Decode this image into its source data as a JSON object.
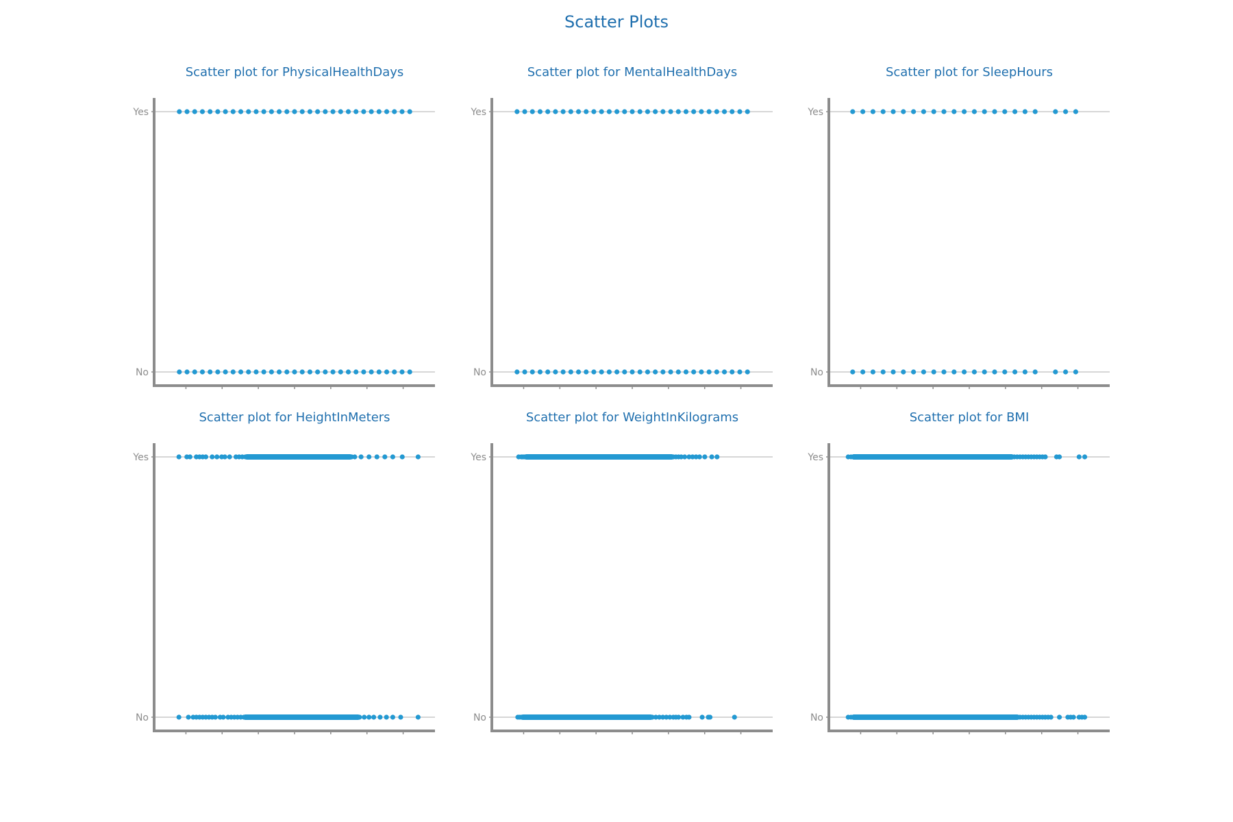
{
  "figure": {
    "title": "Scatter Plots",
    "point_color": "#2399d2",
    "title_color": "#1f6fae",
    "axis_color": "#8c8c8c",
    "grid_color": "#c8c8c8",
    "tick_label_color": "#8c8c8c"
  },
  "chart_data": [
    {
      "type": "scatter",
      "title": "Scatter plot for PhysicalHealthDays",
      "xlim": [
        -1.5,
        31.5
      ],
      "y_categories": [
        "No",
        "Yes"
      ],
      "grid": "horizontal",
      "series": [
        {
          "y": "Yes",
          "x": [
            0,
            1,
            2,
            3,
            4,
            5,
            6,
            7,
            8,
            9,
            10,
            11,
            12,
            13,
            14,
            15,
            16,
            17,
            18,
            19,
            20,
            21,
            22,
            23,
            24,
            25,
            26,
            27,
            28,
            29,
            30
          ]
        },
        {
          "y": "No",
          "x": [
            0,
            1,
            2,
            3,
            4,
            5,
            6,
            7,
            8,
            9,
            10,
            11,
            12,
            13,
            14,
            15,
            16,
            17,
            18,
            19,
            20,
            21,
            22,
            23,
            24,
            25,
            26,
            27,
            28,
            29,
            30
          ]
        }
      ]
    },
    {
      "type": "scatter",
      "title": "Scatter plot for MentalHealthDays",
      "xlim": [
        -1.5,
        31.5
      ],
      "y_categories": [
        "No",
        "Yes"
      ],
      "grid": "horizontal",
      "series": [
        {
          "y": "Yes",
          "x": [
            0,
            1,
            2,
            3,
            4,
            5,
            6,
            7,
            8,
            9,
            10,
            11,
            12,
            13,
            14,
            15,
            16,
            17,
            18,
            19,
            20,
            21,
            22,
            23,
            24,
            25,
            26,
            27,
            28,
            29,
            30
          ]
        },
        {
          "y": "No",
          "x": [
            0,
            1,
            2,
            3,
            4,
            5,
            6,
            7,
            8,
            9,
            10,
            11,
            12,
            13,
            14,
            15,
            16,
            17,
            18,
            19,
            20,
            21,
            22,
            23,
            24,
            25,
            26,
            27,
            28,
            29,
            30
          ]
        }
      ]
    },
    {
      "type": "scatter",
      "title": "Scatter plot for SleepHours",
      "xlim": [
        0,
        25
      ],
      "y_categories": [
        "No",
        "Yes"
      ],
      "grid": "horizontal",
      "series": [
        {
          "y": "Yes",
          "x": [
            1,
            2,
            3,
            4,
            5,
            6,
            7,
            8,
            9,
            10,
            11,
            12,
            13,
            14,
            15,
            16,
            17,
            18,
            19,
            21,
            22,
            23
          ]
        },
        {
          "y": "No",
          "x": [
            1,
            2,
            3,
            4,
            5,
            6,
            7,
            8,
            9,
            10,
            11,
            12,
            13,
            14,
            15,
            16,
            17,
            18,
            19,
            21,
            22,
            23
          ]
        }
      ]
    },
    {
      "type": "scatter",
      "title": "Scatter plot for HeightInMeters",
      "xlim": [
        0.9,
        2.5
      ],
      "y_categories": [
        "No",
        "Yes"
      ],
      "grid": "horizontal",
      "series": [
        {
          "y": "Yes",
          "x": [
            0.97,
            1.02,
            1.04,
            1.08,
            1.1,
            1.12,
            1.14,
            1.18,
            1.21,
            1.24,
            1.26,
            1.29,
            1.33,
            1.35,
            1.37,
            1.39,
            2.06,
            2.08,
            2.12,
            2.17,
            2.22,
            2.27,
            2.32,
            2.38,
            2.48
          ],
          "dense_ranges": [
            [
              1.4,
              2.05
            ]
          ]
        },
        {
          "y": "No",
          "x": [
            0.97,
            1.03,
            1.06,
            1.08,
            1.1,
            1.12,
            1.14,
            1.16,
            1.18,
            1.2,
            1.23,
            1.25,
            1.28,
            1.3,
            1.32,
            1.34,
            1.36,
            1.38,
            2.11,
            2.14,
            2.17,
            2.2,
            2.24,
            2.28,
            2.32,
            2.37,
            2.48
          ],
          "dense_ranges": [
            [
              1.39,
              2.1
            ]
          ]
        }
      ]
    },
    {
      "type": "scatter",
      "title": "Scatter plot for WeightInKilograms",
      "xlim": [
        10,
        300
      ],
      "y_categories": [
        "No",
        "Yes"
      ],
      "grid": "horizontal",
      "series": [
        {
          "y": "Yes",
          "x": [
            25,
            28,
            30,
            32,
            202,
            205,
            208,
            211,
            215,
            220,
            224,
            228,
            232,
            238,
            246,
            252
          ],
          "dense_ranges": [
            [
              34,
              200
            ]
          ]
        },
        {
          "y": "No",
          "x": [
            24,
            26,
            28,
            178,
            182,
            186,
            190,
            194,
            198,
            202,
            205,
            208,
            213,
            217,
            220,
            235,
            242,
            244,
            272
          ],
          "dense_ranges": [
            [
              30,
              176
            ]
          ]
        }
      ]
    },
    {
      "type": "scatter",
      "title": "Scatter plot for BMI",
      "xlim": [
        10,
        100
      ],
      "y_categories": [
        "No",
        "Yes"
      ],
      "grid": "horizontal",
      "series": [
        {
          "y": "Yes",
          "x": [
            12,
            13,
            71,
            72,
            73,
            74,
            75,
            76,
            77,
            78,
            79,
            80,
            81,
            82,
            86,
            87,
            94,
            96
          ],
          "dense_ranges": [
            [
              14,
              70
            ]
          ]
        },
        {
          "y": "No",
          "x": [
            12,
            13,
            73,
            74,
            75,
            76,
            77,
            78,
            79,
            80,
            81,
            82,
            83,
            84,
            87,
            90,
            91,
            92,
            94,
            95,
            96
          ],
          "dense_ranges": [
            [
              14,
              72
            ]
          ]
        }
      ]
    }
  ]
}
